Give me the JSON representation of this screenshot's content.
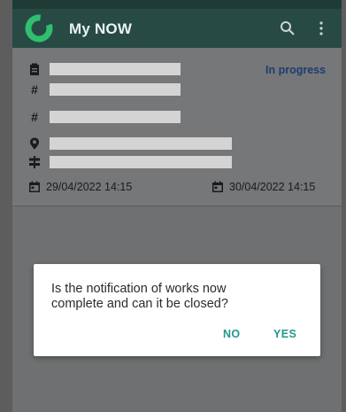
{
  "appbar": {
    "title": "My NOW",
    "icons": [
      "app-logo-icon",
      "search-icon",
      "more-vert-icon"
    ],
    "color": "#284a44"
  },
  "notification": {
    "status": "In progress",
    "status_color": "#1f3b73",
    "start_datetime": "29/04/2022 14:15",
    "end_datetime": "30/04/2022 14:15",
    "field_icons": [
      "clipboard-icon",
      "hash-icon",
      "hash-icon",
      "location-pin-icon",
      "signpost-icon"
    ]
  },
  "dialog": {
    "message": "Is the notification of works now complete and can it be closed?",
    "no_label": "NO",
    "yes_label": "YES",
    "accent": "#1e9a8c"
  }
}
